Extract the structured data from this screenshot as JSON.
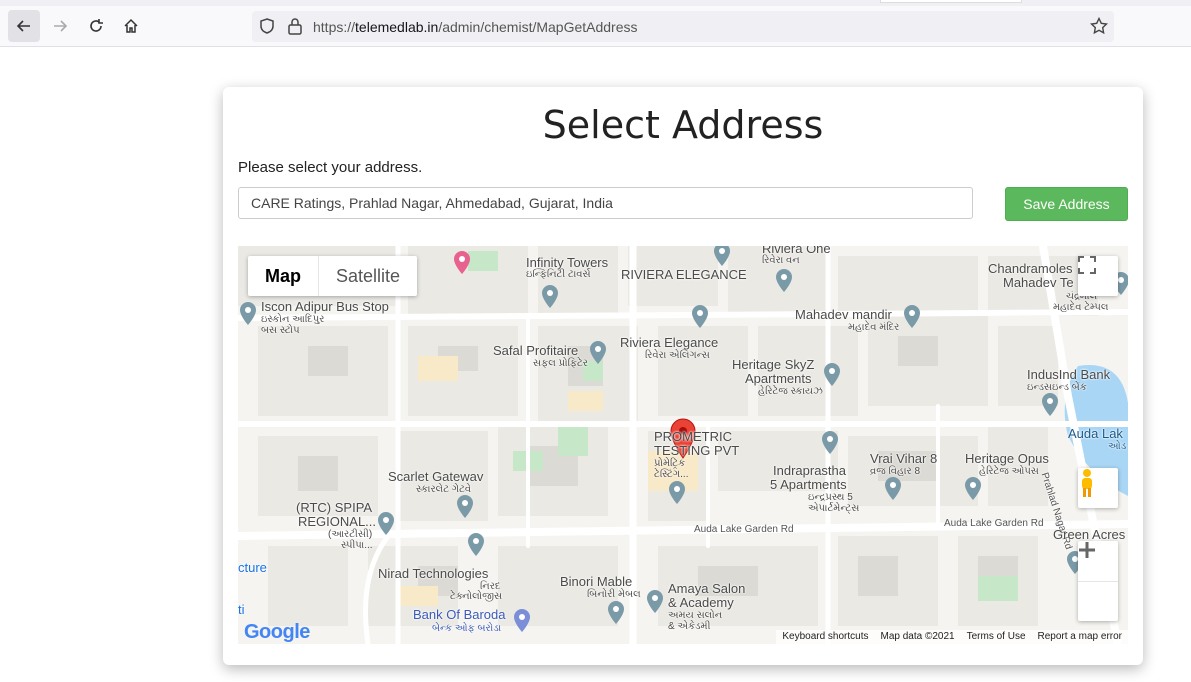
{
  "browser": {
    "url_prefix": "https://",
    "url_domain": "telemedlab.in",
    "url_path": "/admin/chemist/MapGetAddress"
  },
  "page": {
    "title": "Select Address",
    "hint": "Please select your address.",
    "address_value": "CARE Ratings, Prahlad Nagar, Ahmedabad, Gujarat, India",
    "save_label": "Save Address"
  },
  "map": {
    "type_map": "Map",
    "type_satellite": "Satellite",
    "google": "Google",
    "footer": {
      "shortcuts": "Keyboard shortcuts",
      "data": "Map data ©2021",
      "terms": "Terms of Use",
      "report": "Report a map error"
    },
    "labels": {
      "infinity": "Infinity Towers",
      "infinity_gu": "ઇન્ફિનિટી ટાવર્સ",
      "riviera_one": "Riviera One",
      "riviera_one_gu": "રિવેરા વન",
      "riviera_el_caps": "RIVIERA ELEGANCE",
      "chandramoles": "Chandramoles",
      "mahadev_te": "Mahadev Te",
      "chandramoles_gu": "ચંદ્રમૌલ",
      "mahadev_te_gu": "મહાદેવ ટેમ્પલ",
      "iscon": "Iscon Adipur Bus Stop",
      "iscon_gu1": "ઇસ્કોન આદિપુર",
      "iscon_gu2": "બસ સ્ટોપ",
      "mahadev_mandir": "Mahadev mandir",
      "mahadev_mandir_gu": "મહાદેવ મંદિર",
      "safal": "Safal Profitaire",
      "safal_gu": "સફલ પ્રોફિટેર",
      "riviera_el": "Riviera Elegance",
      "riviera_el_gu": "રિવેરા એલિગન્સ",
      "heritage_skyz1": "Heritage SkyZ",
      "heritage_skyz2": "Apartments",
      "heritage_skyz_gu": "હેરિટેજ સ્કાયઝ",
      "indusind": "IndusInd Bank",
      "indusind_gu": "ઇન્ડસઇન્ડ બેંક",
      "audalake": "Auda Lak",
      "audalake_gu": "ઓડ",
      "proetric1": "PROMETRIC",
      "proetric2": "TESTING PVT",
      "proetric_gu1": "પ્રોમેટ્રિક",
      "proetric_gu2": "ટેસ્ટિંગ...",
      "vrai": "Vrai Vihar 8",
      "vrai_gu": "વ્રજ વિહાર 8",
      "heritage_opus": "Heritage Opus",
      "heritage_opus_gu": "હેરિટેજ ઓપસ",
      "prahlad_rd": "Prahlad Nagar Rd",
      "scarlet": "Scarlet Gatewav",
      "scarlet_gu": "સ્કારલેટ ગેટવે",
      "indraprastha1": "Indraprastha",
      "indraprastha2": "5 Apartments",
      "indraprastha_gu1": "ઇન્દ્રપ્રસ્થ 5",
      "indraprastha_gu2": "એપાર્ટમેન્ટ્સ",
      "rtc1": "(RTC) SPIPA",
      "rtc2": "REGIONAL...",
      "rtc_gu1": "(આરટીસી)",
      "rtc_gu2": "સ્પીપા...",
      "auda_rd1": "Auda Lake Garden Rd",
      "auda_rd2": "Auda Lake Garden Rd",
      "green_acres": "Green Acres",
      "cture": "cture",
      "nirad": "Nirad Technologies",
      "nirad_gu1": "નિરદ",
      "nirad_gu2": "ટેક્નોલોજીસ",
      "binori": "Binori Mable",
      "binori_gu": "બિનોરી મેબલ",
      "amaya1": "Amaya Salon",
      "amaya2": "& Academy",
      "amaya_gu1": "અમય સલોન",
      "amaya_gu2": "& એકેડમી",
      "ti": "ti",
      "bob": "Bank Of Baroda",
      "bob_gu": "બેન્ક ઓફ બરોડા"
    }
  }
}
